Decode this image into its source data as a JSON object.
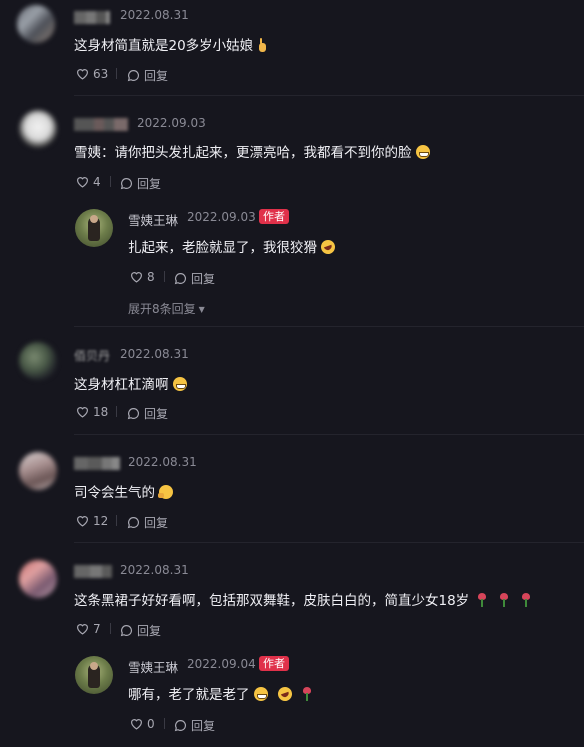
{
  "comments": [
    {
      "date": "2022.08.31",
      "text": "这身材简直就是20多岁小姑娘",
      "likes": "63",
      "reply_label": "回复"
    },
    {
      "date": "2022.09.03",
      "text": "雪姨：请你把头发扎起来，更漂亮哈，我都看不到你的脸",
      "likes": "4",
      "reply_label": "回复",
      "reply": {
        "author": "雪姨王琳",
        "date": "2022.09.03",
        "badge": "作者",
        "text": "扎起来，老脸就显了，我很狡猾",
        "likes": "8",
        "reply_label": "回复"
      },
      "expand_label": "展开8条回复"
    },
    {
      "name_fragment": "佰贝丹",
      "date": "2022.08.31",
      "text": "这身材杠杠滴啊",
      "likes": "18",
      "reply_label": "回复"
    },
    {
      "date": "2022.08.31",
      "text": "司令会生气的",
      "likes": "12",
      "reply_label": "回复"
    },
    {
      "date": "2022.08.31",
      "text": "这条黑裙子好好看啊，包括那双舞鞋，皮肤白白的，简直少女18岁",
      "likes": "7",
      "reply_label": "回复",
      "reply": {
        "author": "雪姨王琳",
        "date": "2022.09.04",
        "badge": "作者",
        "text": "哪有，老了就是老了",
        "likes": "0",
        "reply_label": "回复"
      }
    }
  ],
  "icons": {
    "like": "heart-icon",
    "reply": "speech-bubble-icon",
    "expand": "chevron-down-icon"
  },
  "colors": {
    "background": "#16161e",
    "author_badge": "#e0314a",
    "text": "#f0f0f5",
    "meta": "#8a8a95"
  }
}
